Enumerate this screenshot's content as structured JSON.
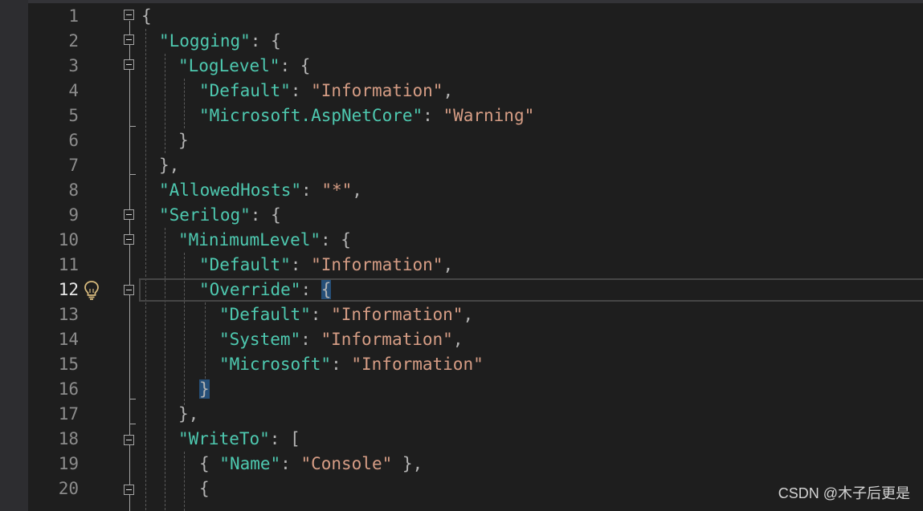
{
  "editor": {
    "current_line": "12",
    "line_numbers": [
      "1",
      "2",
      "3",
      "4",
      "5",
      "6",
      "7",
      "8",
      "9",
      "10",
      "11",
      "12",
      "13",
      "14",
      "15",
      "16",
      "17",
      "18",
      "19",
      "20"
    ],
    "colors": {
      "background": "#1e1e1e",
      "key": "#4ec9b0",
      "string": "#d69d85",
      "punctuation": "#b4b4b4",
      "line_number": "#8c8c8c",
      "brace_highlight": "#264f78"
    },
    "code": {
      "l1": {
        "p1": "{"
      },
      "l2": {
        "key": "\"Logging\"",
        "p1": ": {"
      },
      "l3": {
        "key": "\"LogLevel\"",
        "p1": ": {"
      },
      "l4": {
        "key": "\"Default\"",
        "p1": ": ",
        "str": "\"Information\"",
        "p2": ","
      },
      "l5": {
        "key": "\"Microsoft.AspNetCore\"",
        "p1": ": ",
        "str": "\"Warning\""
      },
      "l6": {
        "p1": "}"
      },
      "l7": {
        "p1": "},"
      },
      "l8": {
        "key": "\"AllowedHosts\"",
        "p1": ": ",
        "str": "\"*\"",
        "p2": ","
      },
      "l9": {
        "key": "\"Serilog\"",
        "p1": ": {"
      },
      "l10": {
        "key": "\"MinimumLevel\"",
        "p1": ": {"
      },
      "l11": {
        "key": "\"Default\"",
        "p1": ": ",
        "str": "\"Information\"",
        "p2": ","
      },
      "l12": {
        "key": "\"Override\"",
        "p1": ": ",
        "brace": "{"
      },
      "l13": {
        "key": "\"Default\"",
        "p1": ": ",
        "str": "\"Information\"",
        "p2": ","
      },
      "l14": {
        "key": "\"System\"",
        "p1": ": ",
        "str": "\"Information\"",
        "p2": ","
      },
      "l15": {
        "key": "\"Microsoft\"",
        "p1": ": ",
        "str": "\"Information\""
      },
      "l16": {
        "brace": "}"
      },
      "l17": {
        "p1": "},"
      },
      "l18": {
        "key": "\"WriteTo\"",
        "p1": ": ["
      },
      "l19": {
        "p0": "{ ",
        "key": "\"Name\"",
        "p1": ": ",
        "str": "\"Console\"",
        "p2": " },"
      },
      "l20": {
        "p1": "{"
      }
    },
    "icons": {
      "lightbulb": "lightbulb-icon",
      "fold": "collapse-icon"
    }
  },
  "watermark": "CSDN @木子后更是"
}
